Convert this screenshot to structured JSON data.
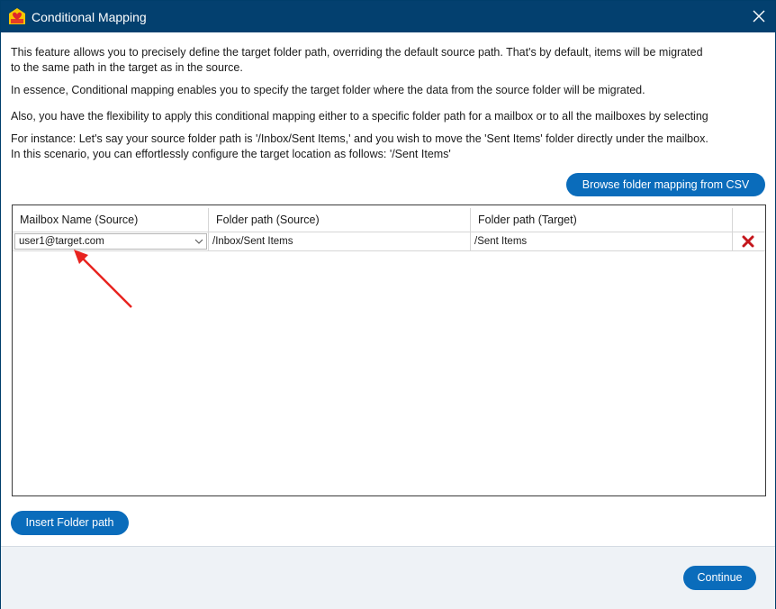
{
  "window": {
    "title": "Conditional Mapping",
    "close_icon": "close-icon",
    "app_icon": "app-logo-icon"
  },
  "description": {
    "line1": "This feature allows you to precisely define the target folder path, overriding the default source path. That's by default, items will be migrated",
    "line1b": "to the same path in the target as in the source.",
    "line2": "In essence, Conditional mapping enables you to specify the target folder where the data from the source folder will be migrated.",
    "line3": "Also, you have the flexibility to apply this conditional mapping either to a specific folder path for a mailbox or to all the mailboxes by selecting",
    "line4": "For instance: Let's say your source folder path is '/Inbox/Sent Items,' and you wish to move the 'Sent Items' folder directly under the mailbox.",
    "line4b": "In this scenario, you can effortlessly configure the target location as follows: '/Sent Items'"
  },
  "buttons": {
    "browse_csv": "Browse folder mapping from CSV",
    "insert_folder_path": "Insert Folder path",
    "continue": "Continue"
  },
  "grid": {
    "columns": [
      "Mailbox Name (Source)",
      "Folder path (Source)",
      "Folder path (Target)"
    ],
    "rows": [
      {
        "mailbox": "user1@target.com",
        "source_path": "/Inbox/Sent Items",
        "target_path": "/Sent Items",
        "delete_icon": "delete-x-icon"
      }
    ]
  },
  "colors": {
    "titlebar": "#03406f",
    "accent": "#0a6cbb",
    "delete": "#c4161c",
    "annotation_arrow": "#e8231f"
  }
}
